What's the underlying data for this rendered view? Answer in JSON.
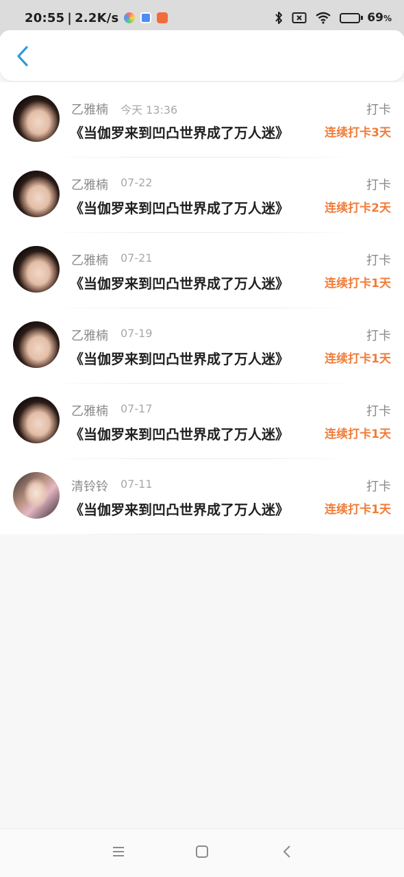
{
  "status_bar": {
    "time": "20:55",
    "separator": "|",
    "network_speed": "2.2K/s",
    "battery_level": 0.69,
    "battery_percent": "69",
    "battery_percent_sign": "%",
    "icons": [
      "photo-app-icon",
      "gallery-app-icon",
      "shop-app-icon",
      "bluetooth-icon",
      "sim-blocked-icon",
      "wifi-icon",
      "battery-icon"
    ],
    "battery_color": "#f0a51c"
  },
  "header": {
    "back_icon": "chevron-left-icon",
    "accent": "#2d9bd8"
  },
  "entries": [
    {
      "name": "乙雅楠",
      "time": "今天 13:36",
      "type": "打卡",
      "title": "《当伽罗来到凹凸世界成了万人迷》",
      "streak": "连续打卡3天"
    },
    {
      "name": "乙雅楠",
      "time": "07-22",
      "type": "打卡",
      "title": "《当伽罗来到凹凸世界成了万人迷》",
      "streak": "连续打卡2天"
    },
    {
      "name": "乙雅楠",
      "time": "07-21",
      "type": "打卡",
      "title": "《当伽罗来到凹凸世界成了万人迷》",
      "streak": "连续打卡1天"
    },
    {
      "name": "乙雅楠",
      "time": "07-19",
      "type": "打卡",
      "title": "《当伽罗来到凹凸世界成了万人迷》",
      "streak": "连续打卡1天"
    },
    {
      "name": "乙雅楠",
      "time": "07-17",
      "type": "打卡",
      "title": "《当伽罗来到凹凸世界成了万人迷》",
      "streak": "连续打卡1天"
    },
    {
      "name": "清铃铃",
      "time": "07-11",
      "type": "打卡",
      "title": "《当伽罗来到凹凸世界成了万人迷》",
      "streak": "连续打卡1天"
    }
  ],
  "streak_color": "#f07c39",
  "nav_bar": {
    "icons": [
      "menu-icon",
      "home-icon",
      "back-icon"
    ]
  }
}
